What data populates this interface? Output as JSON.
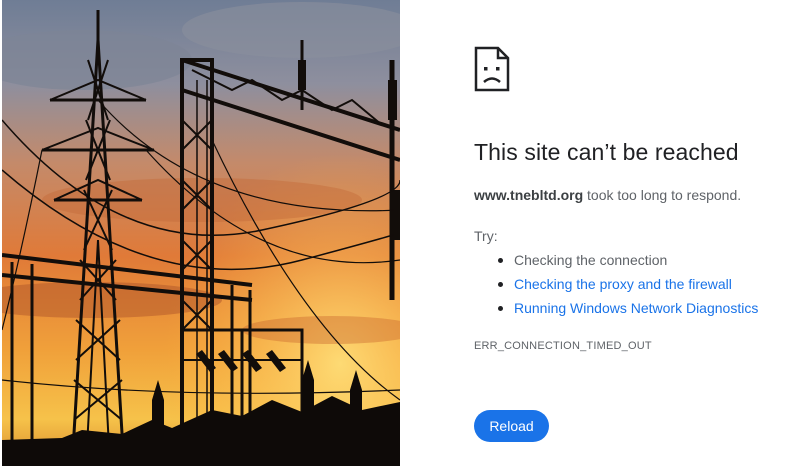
{
  "photo": {
    "description_icon": "power-transmission-towers-image"
  },
  "error_page": {
    "icon": "sad-page-icon",
    "title": "This site can’t be reached",
    "host": "www.tnebltd.org",
    "message": " took too long to respond.",
    "try_label": "Try:",
    "suggestions": [
      {
        "label": "Checking the connection",
        "is_link": false
      },
      {
        "label": "Checking the proxy and the firewall",
        "is_link": true
      },
      {
        "label": "Running Windows Network Diagnostics",
        "is_link": true
      }
    ],
    "error_code": "ERR_CONNECTION_TIMED_OUT",
    "reload_label": "Reload"
  },
  "colors": {
    "link": "#1a73e8",
    "button_bg": "#1a73e8",
    "title_text": "#202124",
    "body_text": "#5f6368"
  }
}
